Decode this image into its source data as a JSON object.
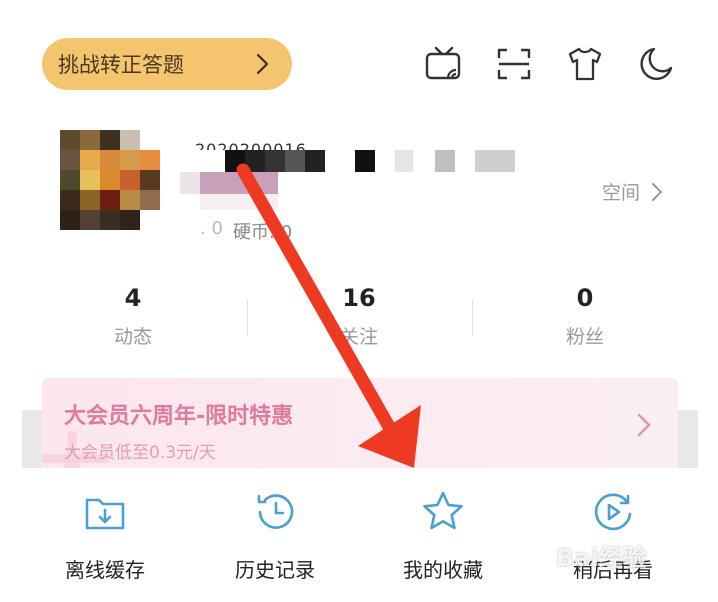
{
  "header": {
    "challenge_label": "挑战转正答题",
    "icons": [
      "tv-cast-icon",
      "scan-icon",
      "tshirt-icon",
      "moon-icon"
    ]
  },
  "profile": {
    "uid_partial": "2020200016",
    "stats_prefix": ". 0",
    "coins": "硬币: 0",
    "space_label": "空间"
  },
  "counts": [
    {
      "value": "4",
      "label": "动态"
    },
    {
      "value": "16",
      "label": "关注"
    },
    {
      "value": "0",
      "label": "粉丝"
    }
  ],
  "vip": {
    "title": "大会员六周年-限时特惠",
    "subtitle": "大会员低至0.3元/天",
    "deco": "大"
  },
  "tools": [
    {
      "label": "离线缓存",
      "icon": "offline-download-icon"
    },
    {
      "label": "历史记录",
      "icon": "history-clock-icon"
    },
    {
      "label": "我的收藏",
      "icon": "star-icon"
    },
    {
      "label": "稍后再看",
      "icon": "watch-later-icon"
    }
  ],
  "watermark": "Bai经验",
  "colors": {
    "accent_yellow": "#f4c46e",
    "icon_blue": "#4a9fd6",
    "vip_pink": "#e07a9a",
    "arrow_red": "#ee3a22"
  }
}
